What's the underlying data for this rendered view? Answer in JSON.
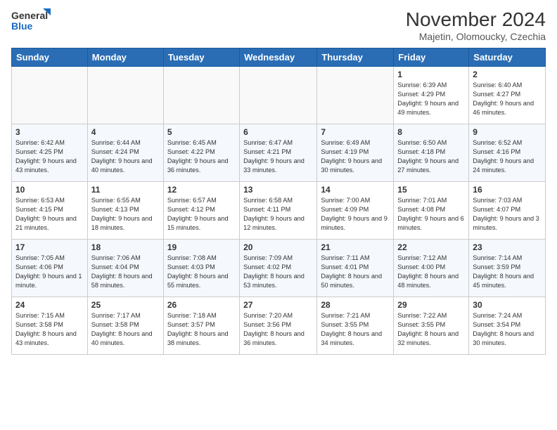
{
  "logo": {
    "line1": "General",
    "line2": "Blue"
  },
  "title": "November 2024",
  "subtitle": "Majetin, Olomoucky, Czechia",
  "days_of_week": [
    "Sunday",
    "Monday",
    "Tuesday",
    "Wednesday",
    "Thursday",
    "Friday",
    "Saturday"
  ],
  "weeks": [
    [
      {
        "day": "",
        "info": ""
      },
      {
        "day": "",
        "info": ""
      },
      {
        "day": "",
        "info": ""
      },
      {
        "day": "",
        "info": ""
      },
      {
        "day": "",
        "info": ""
      },
      {
        "day": "1",
        "info": "Sunrise: 6:39 AM\nSunset: 4:29 PM\nDaylight: 9 hours and 49 minutes."
      },
      {
        "day": "2",
        "info": "Sunrise: 6:40 AM\nSunset: 4:27 PM\nDaylight: 9 hours and 46 minutes."
      }
    ],
    [
      {
        "day": "3",
        "info": "Sunrise: 6:42 AM\nSunset: 4:25 PM\nDaylight: 9 hours and 43 minutes."
      },
      {
        "day": "4",
        "info": "Sunrise: 6:44 AM\nSunset: 4:24 PM\nDaylight: 9 hours and 40 minutes."
      },
      {
        "day": "5",
        "info": "Sunrise: 6:45 AM\nSunset: 4:22 PM\nDaylight: 9 hours and 36 minutes."
      },
      {
        "day": "6",
        "info": "Sunrise: 6:47 AM\nSunset: 4:21 PM\nDaylight: 9 hours and 33 minutes."
      },
      {
        "day": "7",
        "info": "Sunrise: 6:49 AM\nSunset: 4:19 PM\nDaylight: 9 hours and 30 minutes."
      },
      {
        "day": "8",
        "info": "Sunrise: 6:50 AM\nSunset: 4:18 PM\nDaylight: 9 hours and 27 minutes."
      },
      {
        "day": "9",
        "info": "Sunrise: 6:52 AM\nSunset: 4:16 PM\nDaylight: 9 hours and 24 minutes."
      }
    ],
    [
      {
        "day": "10",
        "info": "Sunrise: 6:53 AM\nSunset: 4:15 PM\nDaylight: 9 hours and 21 minutes."
      },
      {
        "day": "11",
        "info": "Sunrise: 6:55 AM\nSunset: 4:13 PM\nDaylight: 9 hours and 18 minutes."
      },
      {
        "day": "12",
        "info": "Sunrise: 6:57 AM\nSunset: 4:12 PM\nDaylight: 9 hours and 15 minutes."
      },
      {
        "day": "13",
        "info": "Sunrise: 6:58 AM\nSunset: 4:11 PM\nDaylight: 9 hours and 12 minutes."
      },
      {
        "day": "14",
        "info": "Sunrise: 7:00 AM\nSunset: 4:09 PM\nDaylight: 9 hours and 9 minutes."
      },
      {
        "day": "15",
        "info": "Sunrise: 7:01 AM\nSunset: 4:08 PM\nDaylight: 9 hours and 6 minutes."
      },
      {
        "day": "16",
        "info": "Sunrise: 7:03 AM\nSunset: 4:07 PM\nDaylight: 9 hours and 3 minutes."
      }
    ],
    [
      {
        "day": "17",
        "info": "Sunrise: 7:05 AM\nSunset: 4:06 PM\nDaylight: 9 hours and 1 minute."
      },
      {
        "day": "18",
        "info": "Sunrise: 7:06 AM\nSunset: 4:04 PM\nDaylight: 8 hours and 58 minutes."
      },
      {
        "day": "19",
        "info": "Sunrise: 7:08 AM\nSunset: 4:03 PM\nDaylight: 8 hours and 55 minutes."
      },
      {
        "day": "20",
        "info": "Sunrise: 7:09 AM\nSunset: 4:02 PM\nDaylight: 8 hours and 53 minutes."
      },
      {
        "day": "21",
        "info": "Sunrise: 7:11 AM\nSunset: 4:01 PM\nDaylight: 8 hours and 50 minutes."
      },
      {
        "day": "22",
        "info": "Sunrise: 7:12 AM\nSunset: 4:00 PM\nDaylight: 8 hours and 48 minutes."
      },
      {
        "day": "23",
        "info": "Sunrise: 7:14 AM\nSunset: 3:59 PM\nDaylight: 8 hours and 45 minutes."
      }
    ],
    [
      {
        "day": "24",
        "info": "Sunrise: 7:15 AM\nSunset: 3:58 PM\nDaylight: 8 hours and 43 minutes."
      },
      {
        "day": "25",
        "info": "Sunrise: 7:17 AM\nSunset: 3:58 PM\nDaylight: 8 hours and 40 minutes."
      },
      {
        "day": "26",
        "info": "Sunrise: 7:18 AM\nSunset: 3:57 PM\nDaylight: 8 hours and 38 minutes."
      },
      {
        "day": "27",
        "info": "Sunrise: 7:20 AM\nSunset: 3:56 PM\nDaylight: 8 hours and 36 minutes."
      },
      {
        "day": "28",
        "info": "Sunrise: 7:21 AM\nSunset: 3:55 PM\nDaylight: 8 hours and 34 minutes."
      },
      {
        "day": "29",
        "info": "Sunrise: 7:22 AM\nSunset: 3:55 PM\nDaylight: 8 hours and 32 minutes."
      },
      {
        "day": "30",
        "info": "Sunrise: 7:24 AM\nSunset: 3:54 PM\nDaylight: 8 hours and 30 minutes."
      }
    ]
  ]
}
